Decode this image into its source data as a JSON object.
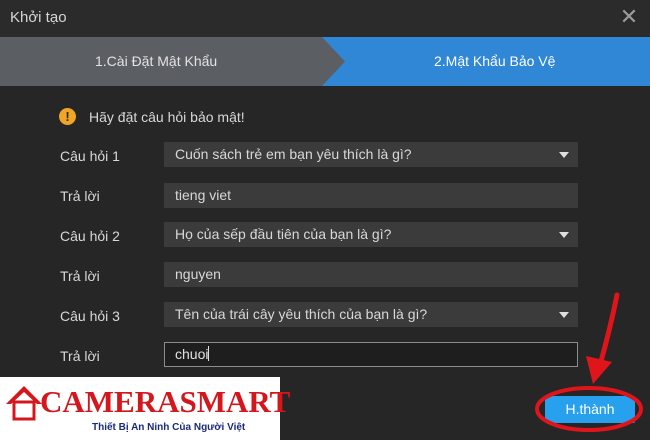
{
  "window": {
    "title": "Khởi tạo",
    "close_icon": "close-icon"
  },
  "steps": [
    {
      "label": "1.Cài Đặt Mật Khẩu",
      "state": "completed"
    },
    {
      "label": "2.Mật Khẩu Bảo Vệ",
      "state": "active"
    }
  ],
  "notice": {
    "icon": "warning-icon",
    "text": "Hãy đặt câu hỏi bảo mật!"
  },
  "questions": [
    {
      "question_label": "Câu hỏi 1",
      "question": "Cuốn sách trẻ em bạn yêu thích là gì?",
      "answer_label": "Trả lời",
      "answer": "tieng viet"
    },
    {
      "question_label": "Câu hỏi 2",
      "question": "Họ của sếp đầu tiên của bạn là gì?",
      "answer_label": "Trả lời",
      "answer": "nguyen"
    },
    {
      "question_label": "Câu hỏi 3",
      "question": "Tên của trái cây yêu thích của bạn là gì?",
      "answer_label": "Trả lời",
      "answer": "chuoi"
    }
  ],
  "finish_button": {
    "label": "H.thành"
  },
  "logo": {
    "brand": "CAMERASMART",
    "tagline": "Thiết Bị An Ninh Của Người Việt"
  },
  "colors": {
    "active_step": "#2f87d6",
    "completed_step": "#5b5e63",
    "finish_button": "#27a0ee",
    "annotation_red": "#e0141b",
    "warning": "#f0a524"
  }
}
